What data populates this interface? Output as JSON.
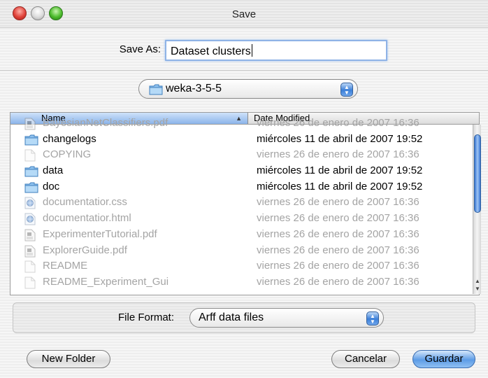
{
  "window": {
    "title": "Save"
  },
  "save_as": {
    "label": "Save As:",
    "value": "Dataset clusters"
  },
  "location": {
    "value": "weka-3-5-5",
    "folder_icon": "folder-icon"
  },
  "browser": {
    "columns": {
      "name": "Name",
      "date": "Date Modified"
    },
    "files": [
      {
        "name": "BayesianNetClassifiers.pdf",
        "date": "viernes 26 de enero de 2007 16:36",
        "icon": "pdf-document-icon",
        "enabled": false
      },
      {
        "name": "changelogs",
        "date": "miércoles 11 de abril de 2007 19:52",
        "icon": "folder-icon",
        "enabled": true
      },
      {
        "name": "COPYING",
        "date": "viernes 26 de enero de 2007 16:36",
        "icon": "document-icon",
        "enabled": false
      },
      {
        "name": "data",
        "date": "miércoles 11 de abril de 2007 19:52",
        "icon": "folder-icon",
        "enabled": true
      },
      {
        "name": "doc",
        "date": "miércoles 11 de abril de 2007 19:52",
        "icon": "folder-icon",
        "enabled": true
      },
      {
        "name": "documentatior.css",
        "date": "viernes 26 de enero de 2007 16:36",
        "icon": "web-document-icon",
        "enabled": false
      },
      {
        "name": "documentatior.html",
        "date": "viernes 26 de enero de 2007 16:36",
        "icon": "web-document-icon",
        "enabled": false
      },
      {
        "name": "ExperimenterTutorial.pdf",
        "date": "viernes 26 de enero de 2007 16:36",
        "icon": "pdf-document-icon",
        "enabled": false
      },
      {
        "name": "ExplorerGuide.pdf",
        "date": "viernes 26 de enero de 2007 16:36",
        "icon": "pdf-document-icon",
        "enabled": false
      },
      {
        "name": "README",
        "date": "viernes 26 de enero de 2007 16:36",
        "icon": "document-icon",
        "enabled": false
      },
      {
        "name": "README_Experiment_Gui",
        "date": "viernes 26 de enero de 2007 16:36",
        "icon": "document-icon",
        "enabled": false
      }
    ]
  },
  "file_format": {
    "label": "File Format:",
    "value": "Arff data files"
  },
  "buttons": {
    "new_folder": "New Folder",
    "cancel": "Cancelar",
    "save": "Guardar"
  },
  "colors": {
    "accent": "#3b7fd8",
    "disabled_text": "#a4a4a4"
  }
}
